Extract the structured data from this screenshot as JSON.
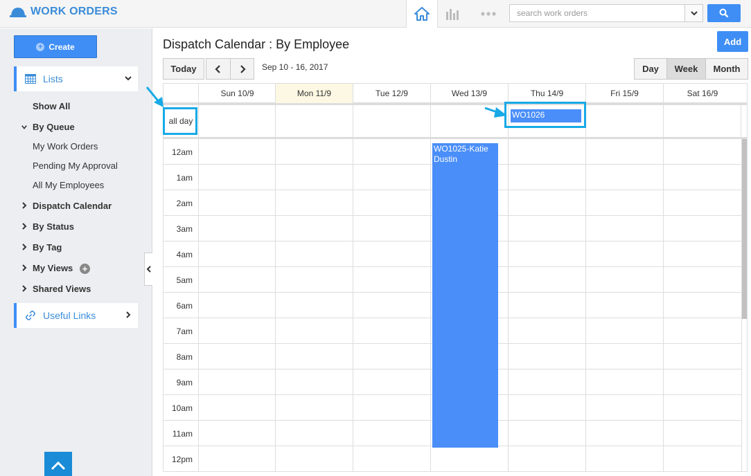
{
  "app": {
    "title": "WORK ORDERS"
  },
  "topbar": {
    "search_placeholder": "search work orders",
    "icons": [
      "home-icon",
      "chart-icon",
      "more-icon",
      "chevron-down-icon",
      "search-icon"
    ]
  },
  "sidebar": {
    "create_label": "Create",
    "lists_label": "Lists",
    "items": [
      {
        "label": "Show All"
      },
      {
        "label": "By Queue"
      },
      {
        "label": "My Work Orders"
      },
      {
        "label": "Pending My Approval"
      },
      {
        "label": "All My Employees"
      },
      {
        "label": "Dispatch Calendar"
      },
      {
        "label": "By Status"
      },
      {
        "label": "By Tag"
      },
      {
        "label": "My Views"
      },
      {
        "label": "Shared Views"
      }
    ],
    "useful_links_label": "Useful Links"
  },
  "main": {
    "title": "Dispatch Calendar : By Employee",
    "add_label": "Add",
    "today_label": "Today",
    "date_range": "Sep 10 - 16, 2017",
    "views": {
      "day": "Day",
      "week": "Week",
      "month": "Month",
      "active": "Week"
    }
  },
  "calendar": {
    "days": [
      "Sun 10/9",
      "Mon 11/9",
      "Tue 12/9",
      "Wed 13/9",
      "Thu 14/9",
      "Fri 15/9",
      "Sat 16/9"
    ],
    "today_index": 1,
    "allday_label": "all day",
    "hours": [
      "12am",
      "1am",
      "2am",
      "3am",
      "4am",
      "5am",
      "6am",
      "7am",
      "8am",
      "9am",
      "10am",
      "11am",
      "12pm"
    ],
    "events": [
      {
        "title": "WO1026",
        "day_index": 4,
        "all_day": true
      },
      {
        "title": "WO1025-Katie Dustin",
        "day_index": 3,
        "all_day": false,
        "start": "12am",
        "end": "12pm"
      }
    ]
  },
  "colors": {
    "accent": "#3f8ef5",
    "event": "#4a8ef9",
    "highlight": "#17a9e6",
    "today": "#fcf8e3"
  }
}
